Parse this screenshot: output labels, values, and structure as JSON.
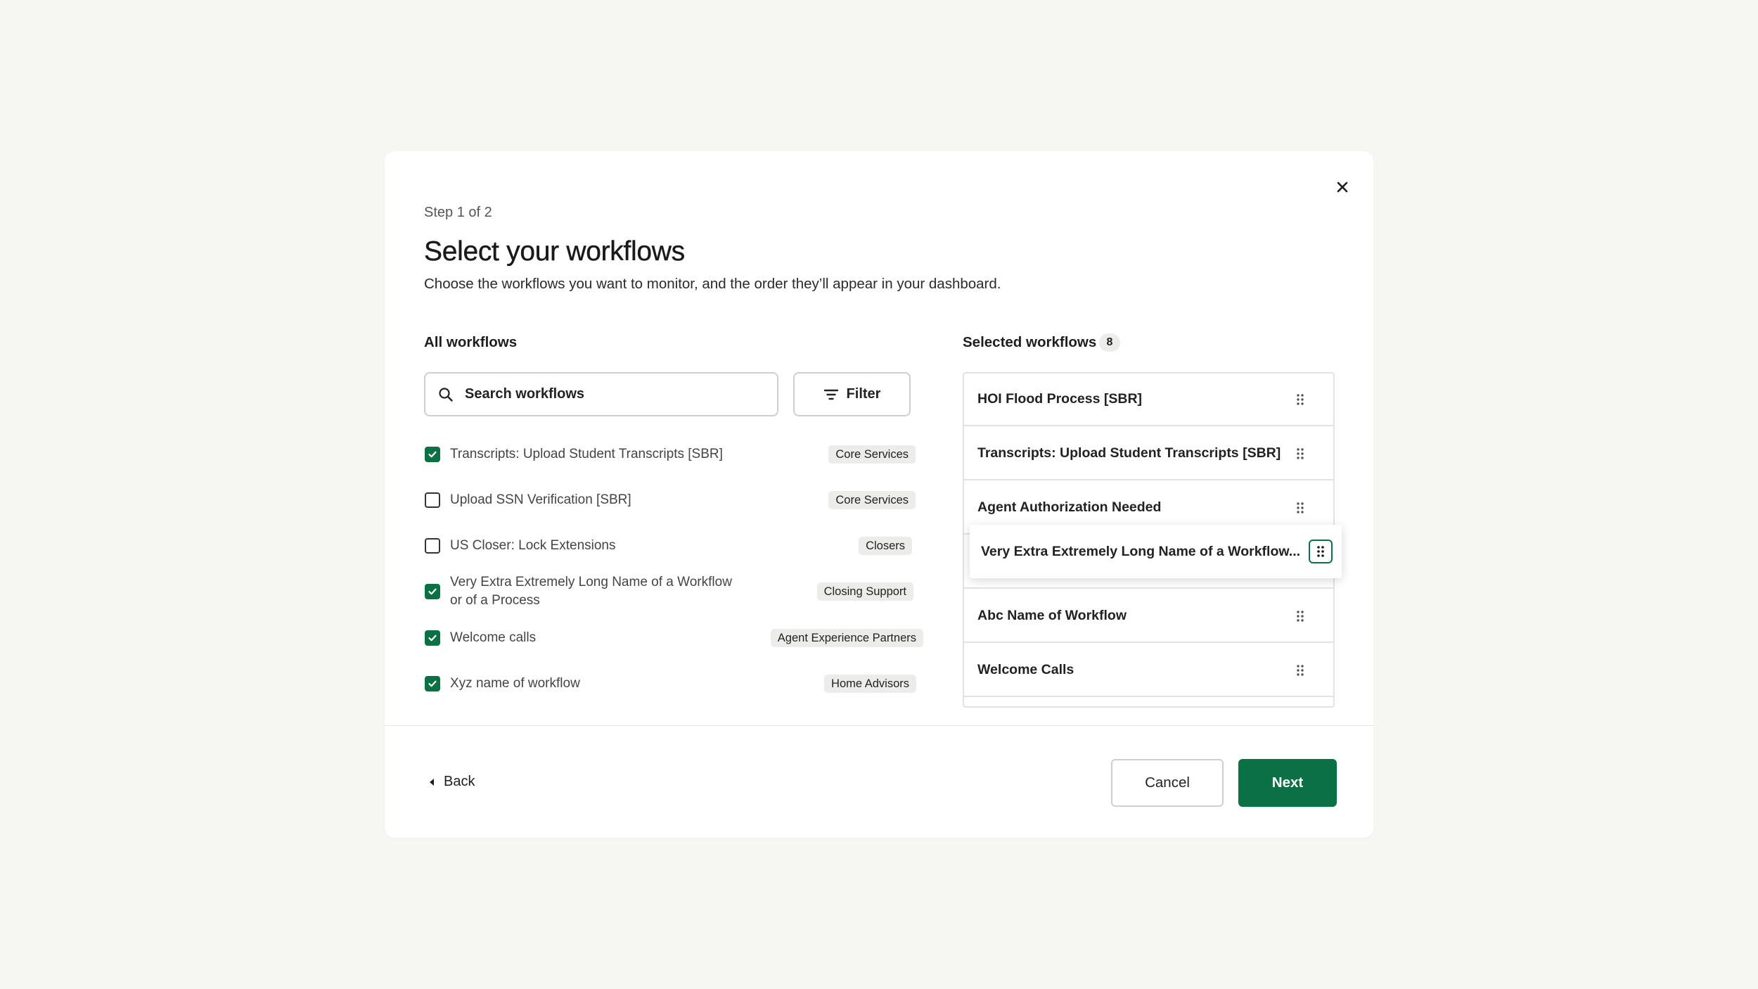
{
  "colors": {
    "accent": "#0b7144",
    "page_background": "#f6f6f3",
    "tag_background": "#ececea"
  },
  "modal": {
    "step": "Step 1 of 2",
    "title": "Select your workflows",
    "subtitle": "Choose the workflows you want to monitor, and the order they’ll appear in your dashboard.",
    "close_icon": "close-icon"
  },
  "all_workflows": {
    "heading": "All workflows",
    "search_placeholder": "Search workflows",
    "search_value": "",
    "filter_label": "Filter",
    "items": [
      {
        "label": "Transcripts: Upload Student Transcripts [SBR]",
        "tag": "Core Services",
        "checked": true
      },
      {
        "label": "Upload SSN Verification [SBR]",
        "tag": "Core Services",
        "checked": false
      },
      {
        "label": "US Closer: Lock Extensions",
        "tag": "Closers",
        "checked": false
      },
      {
        "label": "Very Extra Extremely Long Name of a Workflow or of a Process",
        "tag": "Closing Support",
        "checked": true
      },
      {
        "label": "Welcome calls",
        "tag": "Agent Experience Partners",
        "checked": true
      },
      {
        "label": "Xyz name of workflow",
        "tag": "Home Advisors",
        "checked": true
      }
    ]
  },
  "selected_workflows": {
    "heading": "Selected workflows",
    "count": "8",
    "items": [
      {
        "label": "HOI Flood Process [SBR]"
      },
      {
        "label": "Transcripts: Upload Student Transcripts [SBR]"
      },
      {
        "label": "Agent Authorization Needed"
      },
      {
        "label": ""
      },
      {
        "label": "Abc Name of Workflow"
      },
      {
        "label": "Welcome Calls"
      }
    ],
    "dragging_item": "Very Extra Extremely Long Name of a Workflow..."
  },
  "footer": {
    "back_label": "Back",
    "cancel_label": "Cancel",
    "next_label": "Next"
  }
}
